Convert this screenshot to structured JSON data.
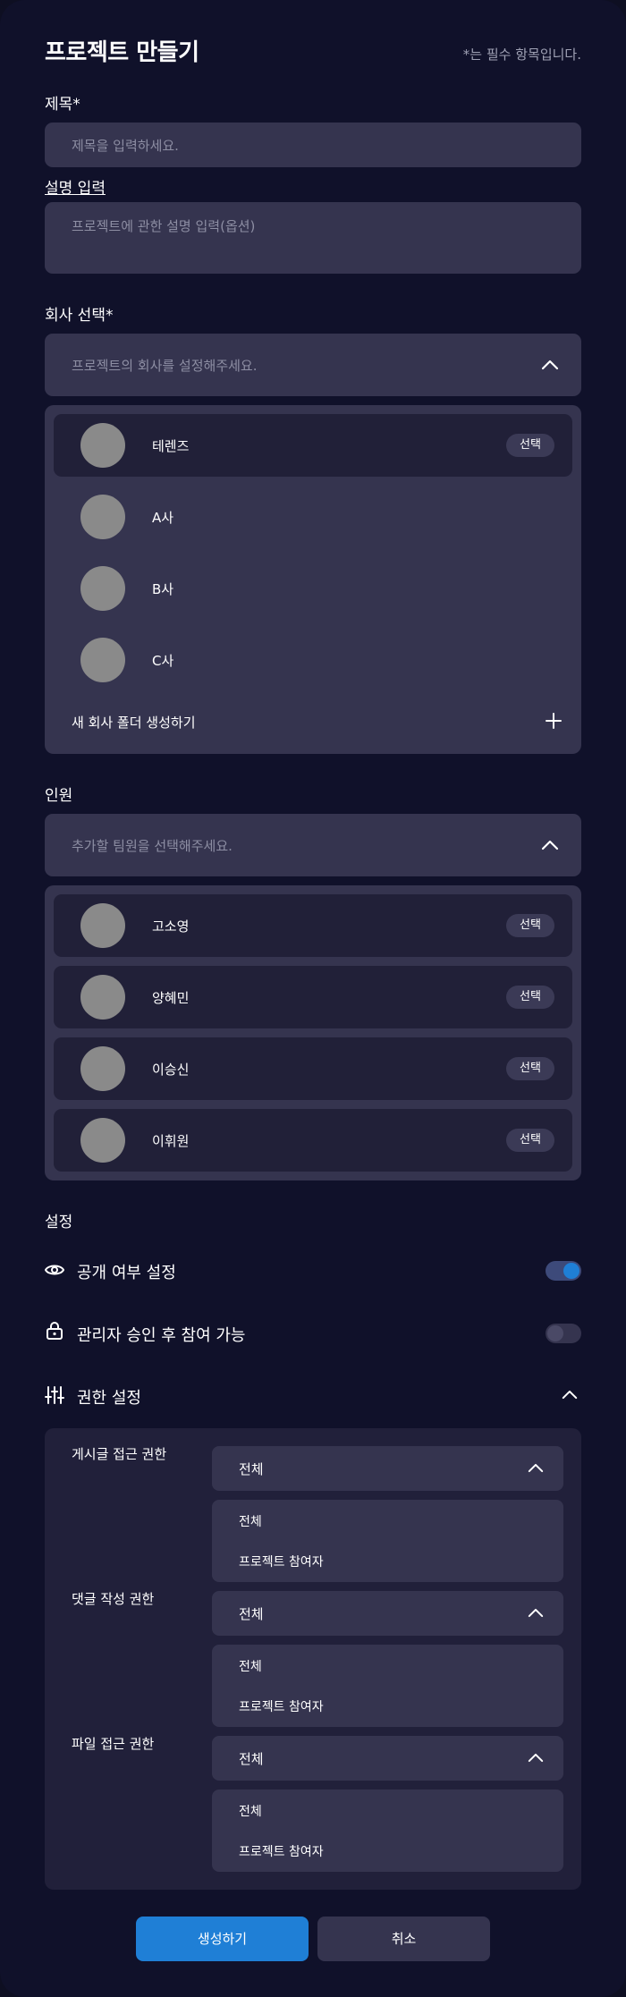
{
  "header": {
    "title": "프로젝트 만들기",
    "required_note": "*는 필수 항목입니다."
  },
  "title_field": {
    "label": "제목*",
    "placeholder": "제목을 입력하세요."
  },
  "description_field": {
    "label": "설명 입력",
    "placeholder": "프로젝트에 관한 설명 입력(옵션)"
  },
  "company": {
    "label": "회사 선택*",
    "placeholder": "프로젝트의 회사를 설정해주세요.",
    "chevron_icon": "chevron-up-icon",
    "items": [
      {
        "name": "테렌즈",
        "selected": true,
        "action": "선택"
      },
      {
        "name": "A사",
        "selected": false,
        "action": ""
      },
      {
        "name": "B사",
        "selected": false,
        "action": ""
      },
      {
        "name": "C사",
        "selected": false,
        "action": ""
      }
    ],
    "new_folder_label": "새 회사 폴더 생성하기",
    "new_folder_icon": "plus-icon"
  },
  "members": {
    "label": "인원",
    "placeholder": "추가할 팀원을 선택해주세요.",
    "chevron_icon": "chevron-up-icon",
    "items": [
      {
        "name": "고소영",
        "action": "선택"
      },
      {
        "name": "양혜민",
        "action": "선택"
      },
      {
        "name": "이승신",
        "action": "선택"
      },
      {
        "name": "이휘원",
        "action": "선택"
      }
    ]
  },
  "settings": {
    "label": "설정",
    "visibility": {
      "label": "공개 여부 설정",
      "icon": "eye-icon",
      "enabled": true
    },
    "approval": {
      "label": "관리자 승인 후 참여 가능",
      "icon": "lock-icon",
      "enabled": false
    },
    "permissions": {
      "label": "권한 설정",
      "icon": "sliders-icon",
      "chevron_icon": "chevron-up-icon",
      "rows": [
        {
          "label": "게시글 접근 권한",
          "value": "전체",
          "options": [
            "전체",
            "프로젝트 참여자"
          ]
        },
        {
          "label": "댓글 작성 권한",
          "value": "전체",
          "options": [
            "전체",
            "프로젝트 참여자"
          ]
        },
        {
          "label": "파일 접근 권한",
          "value": "전체",
          "options": [
            "전체",
            "프로젝트 참여자"
          ]
        }
      ]
    }
  },
  "actions": {
    "create_label": "생성하기",
    "cancel_label": "취소"
  },
  "colors": {
    "background": "#10112a",
    "field": "#35344f",
    "row_dark": "#212038",
    "accent": "#1f7fd6",
    "avatar": "#8a8a8a"
  }
}
